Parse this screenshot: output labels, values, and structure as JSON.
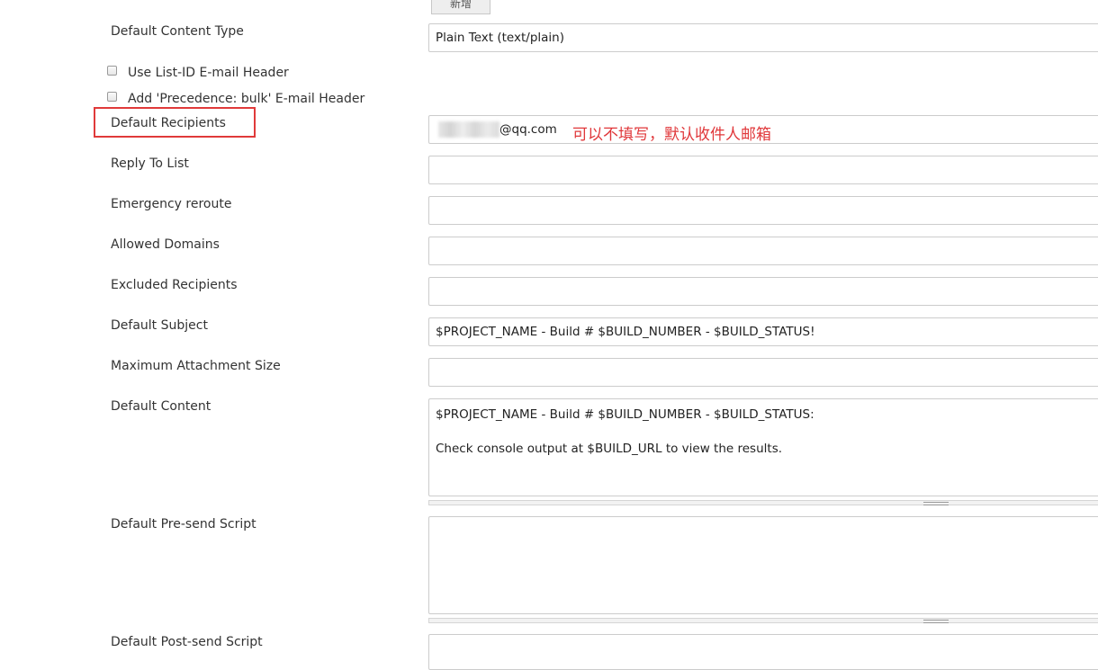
{
  "top_button": {
    "label": "新增"
  },
  "form": {
    "content_type": {
      "label": "Default Content Type",
      "value": "Plain Text (text/plain)"
    },
    "use_list_id": {
      "label": "Use List-ID E-mail Header"
    },
    "precedence_bulk": {
      "label": "Add 'Precedence: bulk' E-mail Header"
    },
    "recipients": {
      "label": "Default Recipients",
      "value": "@qq.com",
      "annotation": "可以不填写，默认收件人邮箱"
    },
    "reply_to": {
      "label": "Reply To List",
      "value": ""
    },
    "emergency": {
      "label": "Emergency reroute",
      "value": ""
    },
    "domains": {
      "label": "Allowed Domains",
      "value": ""
    },
    "excluded": {
      "label": "Excluded Recipients",
      "value": ""
    },
    "subject": {
      "label": "Default Subject",
      "value": "$PROJECT_NAME - Build # $BUILD_NUMBER - $BUILD_STATUS!"
    },
    "max_attach": {
      "label": "Maximum Attachment Size",
      "value": ""
    },
    "content": {
      "label": "Default Content",
      "value": "$PROJECT_NAME - Build # $BUILD_NUMBER - $BUILD_STATUS:\n\nCheck console output at $BUILD_URL to view the results."
    },
    "presend": {
      "label": "Default Pre-send Script",
      "value": ""
    },
    "postsend": {
      "label": "Default Post-send Script",
      "value": ""
    }
  }
}
